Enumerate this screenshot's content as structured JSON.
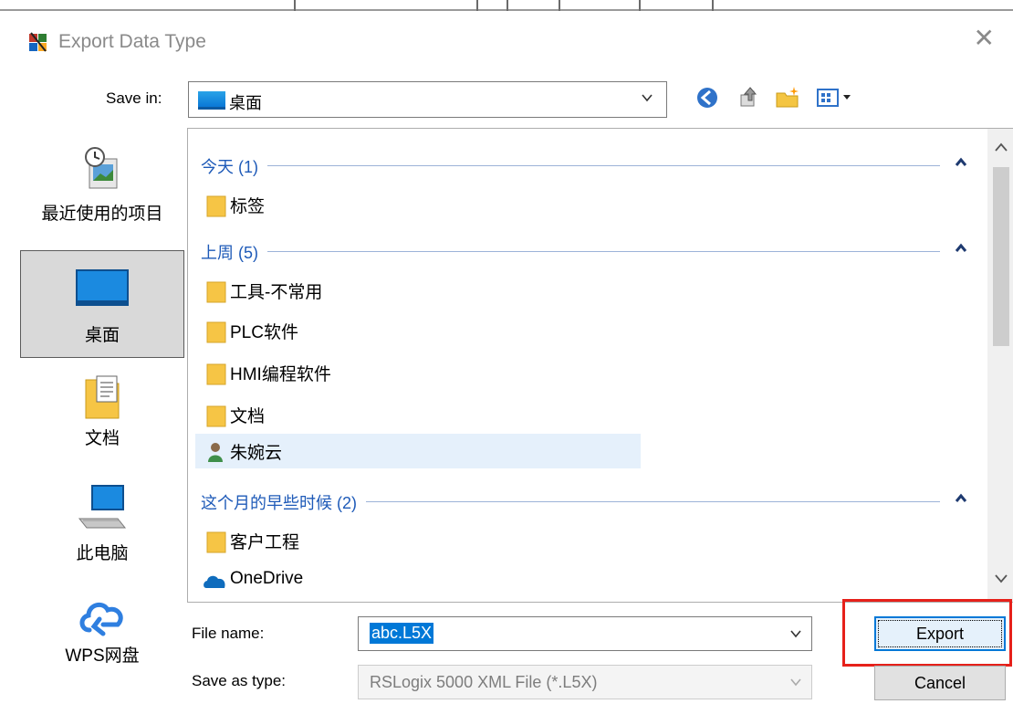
{
  "window": {
    "title": "Export Data Type",
    "close_glyph": "✕",
    "icon": "app-icon"
  },
  "save_in": {
    "label": "Save in:",
    "value": "桌面",
    "toolbar_icons": [
      "back-icon",
      "up-folder-icon",
      "new-folder-icon",
      "view-menu-icon"
    ]
  },
  "places": [
    {
      "label": "最近使用的项目",
      "icon": "recent-places-icon"
    },
    {
      "label": "桌面",
      "icon": "desktop-icon",
      "active": true
    },
    {
      "label": "文档",
      "icon": "documents-icon"
    },
    {
      "label": "此电脑",
      "icon": "this-pc-icon"
    },
    {
      "label": "WPS网盘",
      "icon": "cloud-icon"
    }
  ],
  "file_list": {
    "groups": [
      {
        "title": "今天 (1)",
        "items": [
          "标签"
        ]
      },
      {
        "title": "上周 (5)",
        "items": [
          "工具-不常用",
          "PLC软件",
          "HMI编程软件",
          "文档",
          "朱婉云"
        ]
      },
      {
        "title": "这个月的早些时候 (2)",
        "items": [
          "客户工程",
          "OneDrive"
        ]
      }
    ]
  },
  "file_name": {
    "label": "File name:",
    "value": "abc.L5X"
  },
  "save_as_type": {
    "label": "Save as type:",
    "value": "RSLogix 5000 XML File (*.L5X)"
  },
  "buttons": {
    "export": "Export",
    "cancel": "Cancel"
  },
  "colors": {
    "group_header": "#1e5ab8",
    "selection": "#0078d7",
    "annotation_box": "#e6201a"
  }
}
